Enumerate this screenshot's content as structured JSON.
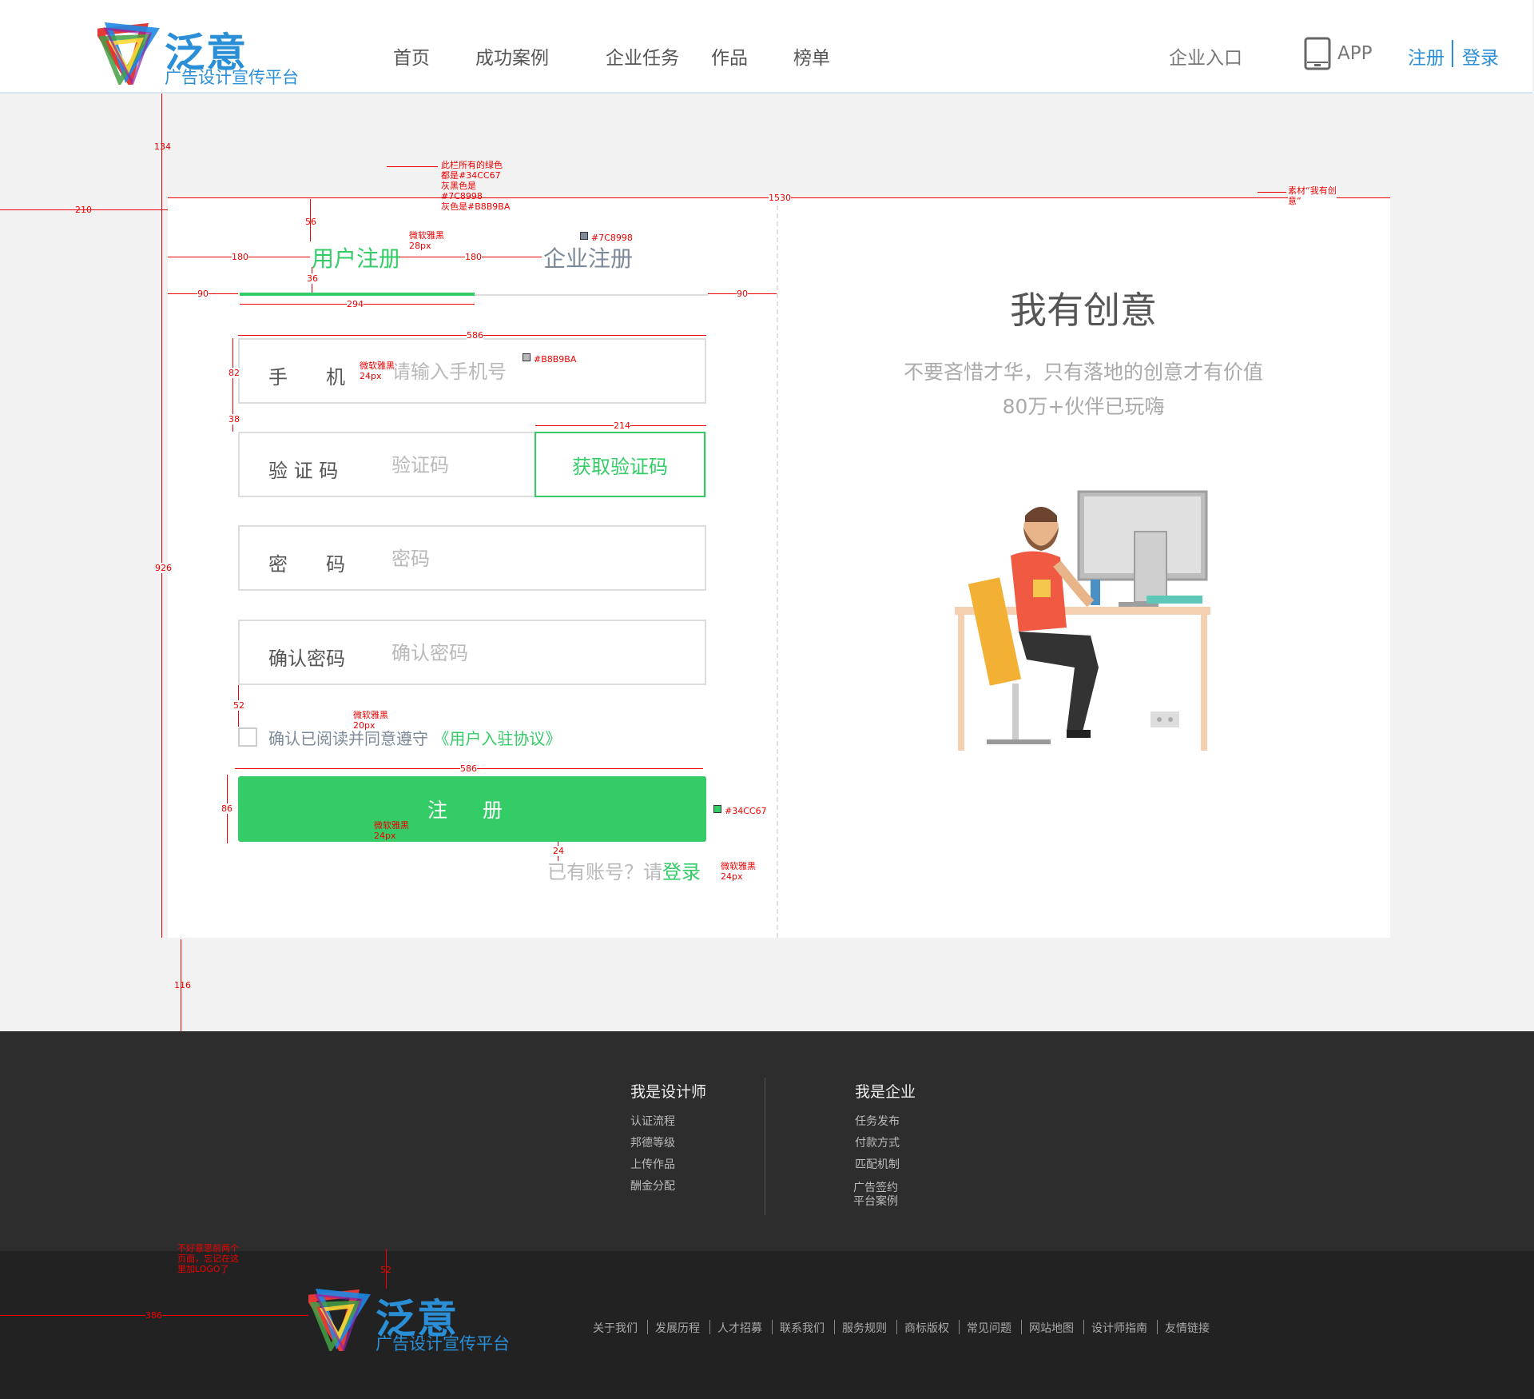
{
  "header": {
    "logo_title": "泛意",
    "logo_subtitle": "广告设计宣传平台",
    "nav": [
      "首页",
      "成功案例",
      "企业任务",
      "作品",
      "榜单"
    ],
    "corp_entry": "企业入口",
    "app_label": "APP",
    "register": "注册",
    "login": "登录"
  },
  "form": {
    "tab_user": "用户注册",
    "tab_corp": "企业注册",
    "fields": [
      {
        "label": "手　　机",
        "placeholder": "请输入手机号"
      },
      {
        "label": "验 证 码",
        "placeholder": "验证码"
      },
      {
        "label": "密　　码",
        "placeholder": "密码"
      },
      {
        "label": "确认密码",
        "placeholder": "确认密码"
      }
    ],
    "get_code": "获取验证码",
    "agree_text": "确认已阅读并同意遵守",
    "agree_link": "《用户入驻协议》",
    "submit": "注 册",
    "login_hint": "已有账号？请",
    "login_link": "登录"
  },
  "promo": {
    "title": "我有创意",
    "subtitle_1": "不要吝惜才华，只有落地的创意才有价值",
    "subtitle_2": "80万+伙伴已玩嗨"
  },
  "footer": {
    "designer_title": "我是设计师",
    "designer_links": [
      "认证流程",
      "邦德等级",
      "上传作品",
      "酬金分配"
    ],
    "company_title": "我是企业",
    "company_links": [
      "任务发布",
      "付款方式",
      "匹配机制"
    ],
    "company_extra_1": "广告签约",
    "company_extra_2": "平台案例",
    "bottom_links": [
      "关于我们",
      "发展历程",
      "人才招募",
      "联系我们",
      "服务规则",
      "商标版权",
      "常见问题",
      "网站地图",
      "设计师指南",
      "友情链接"
    ]
  },
  "annotations": {
    "top_gap": "134",
    "left_margin": "210",
    "card_width": "1530",
    "card_height": "926",
    "bottom_gap": "116",
    "tab_top": "56",
    "tab_left": "180",
    "tab_gap": "180",
    "tab_below": "36",
    "track_left": "90",
    "track_right": "90",
    "active_width": "294",
    "field_width": "586",
    "field_height": "82",
    "field_gap": "38",
    "code_width": "214",
    "agree_gap": "52",
    "btn_width": "586",
    "btn_height": "86",
    "login_gap": "24",
    "footer_gap": "52",
    "footer_left": "386",
    "color_note_1": "此栏所有的绿色",
    "color_note_2": "都是#34CC67",
    "color_note_3": "灰黑色是",
    "color_note_4": "#7C8998",
    "color_note_5": "灰色是#B8B9BA",
    "material_note_1": "素材“我有创",
    "material_note_2": "意”",
    "font_tab_1": "微软雅黑",
    "font_tab_2": "28px",
    "swatch_gray": "#7C8998",
    "font_field_1": "微软雅黑",
    "font_field_2": "24px",
    "swatch_light": "#B8B9BA",
    "font_agree_1": "微软雅黑",
    "font_agree_2": "20px",
    "font_btn_1": "微软雅黑",
    "font_btn_2": "24px",
    "swatch_green": "#34CC67",
    "font_login_1": "微软雅黑",
    "font_login_2": "24px",
    "footer_note_1": "不好意思前两个",
    "footer_note_2": "页面，忘记在这",
    "footer_note_3": "里加LOGO了"
  },
  "colors": {
    "green": "#34CC67",
    "gray_dark": "#7C8998",
    "gray_light": "#B8B9BA",
    "brand_blue": "#2a8fd6"
  }
}
